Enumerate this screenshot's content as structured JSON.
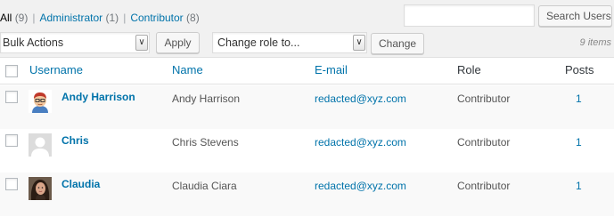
{
  "filters": {
    "all_label": "All",
    "all_count": "(9)",
    "admin_label": "Administrator",
    "admin_count": "(1)",
    "contributor_label": "Contributor",
    "contributor_count": "(8)",
    "separator": "|"
  },
  "search": {
    "value": "",
    "button_label": "Search Users"
  },
  "bulk_actions": {
    "selected": "Bulk Actions",
    "apply_label": "Apply"
  },
  "change_role": {
    "selected": "Change role to...",
    "button_label": "Change"
  },
  "items_count": "9 items",
  "table": {
    "columns": {
      "username": "Username",
      "name": "Name",
      "email": "E-mail",
      "role": "Role",
      "posts": "Posts"
    },
    "rows": [
      {
        "username": "Andy Harrison",
        "name": "Andy Harrison",
        "email": "redacted@xyz.com",
        "role": "Contributor",
        "posts": "1",
        "avatar": "cartoon-avatar"
      },
      {
        "username": "Chris",
        "name": "Chris Stevens",
        "email": "redacted@xyz.com",
        "role": "Contributor",
        "posts": "1",
        "avatar": "default-avatar"
      },
      {
        "username": "Claudia",
        "name": "Claudia Ciara",
        "email": "redacted@xyz.com",
        "role": "Contributor",
        "posts": "1",
        "avatar": "photo-avatar"
      }
    ]
  },
  "colors": {
    "link": "#0073aa",
    "row_alt": "#f9f9f9",
    "background": "#f1f1f1"
  }
}
